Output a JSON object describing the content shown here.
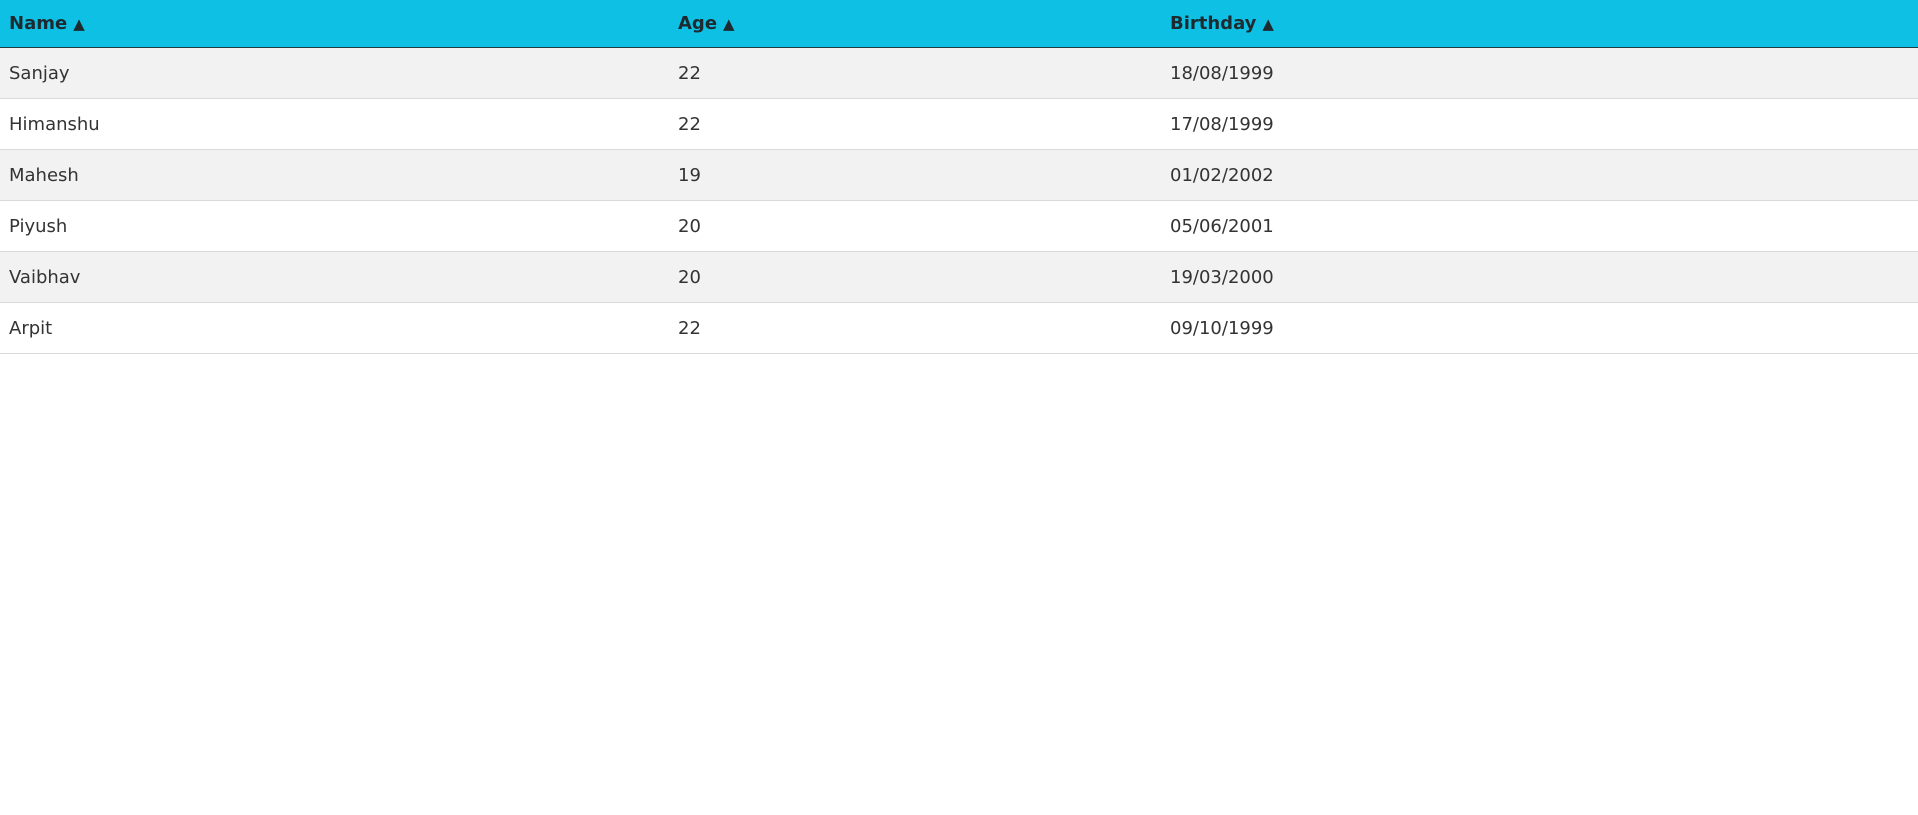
{
  "table": {
    "headers": [
      {
        "label": "Name",
        "sort_icon": "▲",
        "icon_name": "sort-ascending-icon"
      },
      {
        "label": "Age",
        "sort_icon": "▲",
        "icon_name": "sort-ascending-icon"
      },
      {
        "label": "Birthday",
        "sort_icon": "▲",
        "icon_name": "sort-ascending-icon"
      }
    ],
    "rows": [
      {
        "name": "Sanjay",
        "age": "22",
        "birthday": "18/08/1999"
      },
      {
        "name": "Himanshu",
        "age": "22",
        "birthday": "17/08/1999"
      },
      {
        "name": "Mahesh",
        "age": "19",
        "birthday": "01/02/2002"
      },
      {
        "name": "Piyush",
        "age": "20",
        "birthday": "05/06/2001"
      },
      {
        "name": "Vaibhav",
        "age": "20",
        "birthday": "19/03/2000"
      },
      {
        "name": "Arpit",
        "age": "22",
        "birthday": "09/10/1999"
      }
    ]
  },
  "colors": {
    "header_background": "#0ec0e3",
    "row_striped": "#f2f2f2",
    "row_plain": "#ffffff"
  }
}
